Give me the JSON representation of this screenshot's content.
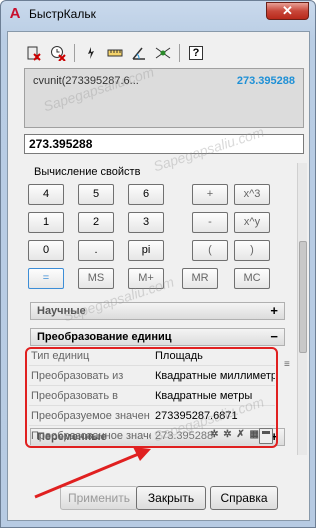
{
  "window": {
    "title": "БыстрКальк",
    "close_symbol": "✕"
  },
  "toolbar": {
    "icons": [
      "clear-icon",
      "clear-history-icon",
      "get-coordinates-icon",
      "distance-icon",
      "angle-icon",
      "intersection-icon",
      "help-icon"
    ],
    "help_label": "?"
  },
  "history": {
    "expression": "cvunit(273395287.6...",
    "result": "273.395288"
  },
  "input": {
    "value": "273.395288"
  },
  "properties": {
    "label": "Вычисление свойств"
  },
  "keypad": {
    "rows": [
      [
        "4",
        "5",
        "6",
        "+",
        "x^3"
      ],
      [
        "1",
        "2",
        "3",
        "-",
        "x^y"
      ],
      [
        "0",
        ".",
        "pi",
        "(",
        ")"
      ],
      [
        "=",
        "MS",
        "M+",
        "MR",
        "MC"
      ]
    ]
  },
  "sections": {
    "scientific": {
      "label": "Научные",
      "toggle": "+"
    },
    "units": {
      "label": "Преобразование единиц",
      "toggle": "−"
    },
    "variables": {
      "label": "Переменные",
      "toggle": "+"
    }
  },
  "unit_conversion": {
    "rows": [
      {
        "label": "Тип единиц",
        "value": "Площадь"
      },
      {
        "label": "Преобразовать из",
        "value": "Квадратные миллиметр"
      },
      {
        "label": "Преобразовать в",
        "value": "Квадратные метры"
      },
      {
        "label": "Преобразуемое значен",
        "value": "273395287.6871"
      },
      {
        "label": "Преобразованное значе",
        "value": "273.395288"
      }
    ]
  },
  "footer": {
    "apply": "Применить",
    "close": "Закрыть",
    "help": "Справка"
  },
  "watermark": {
    "text": "Sapegapsaliu.com"
  },
  "colors": {
    "accent_blue": "#1e90d6",
    "annotation_red": "#e02020"
  }
}
